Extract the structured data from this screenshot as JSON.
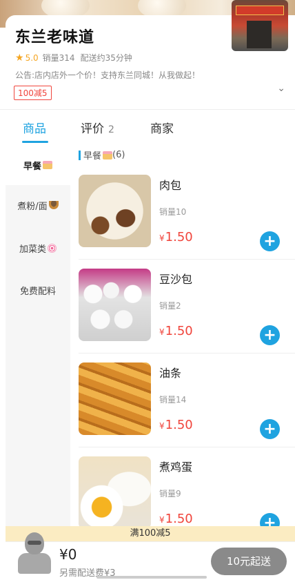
{
  "shop": {
    "name": "东兰老味道",
    "rating": "5.0",
    "sales": "销量314",
    "delivery_time": "配送约35分钟",
    "notice": "公告:店内店外一个价！支持东兰同城！从我做起！",
    "promo_badge": "100减5"
  },
  "tabs": [
    {
      "label": "商品",
      "active": true
    },
    {
      "label": "评价",
      "count": "2",
      "active": false
    },
    {
      "label": "商家",
      "active": false
    }
  ],
  "sidebar": {
    "items": [
      {
        "label": "早餐",
        "icon": "cake-emoji",
        "active": true
      },
      {
        "label": "煮粉/面",
        "icon": "bowl-emoji",
        "active": false
      },
      {
        "label": "加菜类",
        "icon": "fishcake-emoji",
        "active": false
      },
      {
        "label": "免费配料",
        "active": false
      }
    ]
  },
  "category": {
    "title": "早餐",
    "count": "(6)"
  },
  "products": [
    {
      "name": "肉包",
      "sales": "销量10",
      "currency": "¥",
      "price": "1.50",
      "image": "steamed-pork-bun"
    },
    {
      "name": "豆沙包",
      "sales": "销量2",
      "currency": "¥",
      "price": "1.50",
      "image": "red-bean-bun"
    },
    {
      "name": "油条",
      "sales": "销量14",
      "currency": "¥",
      "price": "1.50",
      "image": "fried-dough-stick"
    },
    {
      "name": "煮鸡蛋",
      "sales": "销量9",
      "currency": "¥",
      "price": "1.50",
      "image": "boiled-egg"
    }
  ],
  "promo_strip": "满100减5",
  "cart": {
    "total": "¥0",
    "delivery_fee": "另需配送费¥3",
    "checkout_label": "10元起送"
  },
  "colors": {
    "accent": "#1fa3e0",
    "price": "#f0443b",
    "rating": "#f5a623",
    "promo_strip_bg": "#fbecc2",
    "checkout_disabled": "#8a8a8a"
  }
}
